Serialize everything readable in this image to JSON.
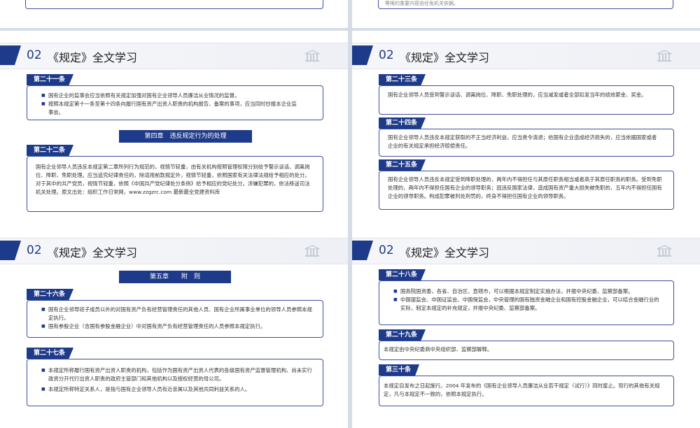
{
  "top": {
    "left_text": "",
    "right_text": "等根的重要内容由任免机关依据。"
  },
  "header": {
    "num": "02",
    "title": "《规定》全文学习"
  },
  "slide1": {
    "a21_label": "第二十一条",
    "a21_items": [
      "国有企业的监事会应当依照有关规定加强对国有企业领导人员廉洁从业情况的监督。",
      "按照本规定第十一条至第十四条向履行国有资产出资人职责的机构报告、备案的事项，应当同时抄报本企业监事会。"
    ],
    "chapter4": "第四章　违反规定行为的处理",
    "a22_label": "第二十二条",
    "a22_text": "国有企业领导人员违反本规定第二章所列行为规范的，视情节轻重，由有关机构按照管理权限分别给予警示谈话、调离岗位、降职、免职处理。应当追究纪律责任的，除适用前款规定外，视情节轻重，依照国家有关法律法规给予相应的处分。对于其中的共产党员，视情节轻重，依照《中国共产党纪律处分条例》给予相应的党纪处分。涉嫌犯罪的，依法移送司法机关处理。原文出处：组织工作日常网，www.zzgzrc.com 最新最全党建资料库"
  },
  "slide2": {
    "a23_label": "第二十三条",
    "a23_text": "国有企业领导人员受到警示谈话、调离岗位、降职、免职处理的，应当减发或者全部扣发当年的绩效薪金、奖金。",
    "a24_label": "第二十四条",
    "a24_text": "国有企业领导人员违反本规定获取的不正当经济利益，应当责令清退；给国有企业造成经济损失的，应当依据国家或者企业的有关规定承担经济赔偿责任。",
    "a25_label": "第二十五条",
    "a25_text": "国有企业领导人员违反本规定受到降职处理的，两年内不得担任与其原任职务相当或者高于其原任职务的职务。受到免职处理的，两年内不得担任国有企业的领导职务；因违反国家法律，造成国有资产重大损失被免职的，五年内不得担任国有企业的领导职务。构成犯罪被判处刑罚的，终身不得担任国有企业的领导职务。"
  },
  "slide3": {
    "chapter5": "第五章　　附　则",
    "a26_label": "第二十六条",
    "a26_items": [
      "国有企业领导班子成员以外的对国有资产负有经营管理责任的其他人员、国有企业所属事业单位的领导人员参照本规定执行。",
      "国有参股企业（含国有参股金融企业）中对国有资产负有经营管理责任的人员参照本规定执行。"
    ],
    "a27_label": "第二十七条",
    "a27_items": [
      "本规定所称履行国有资产出资人职责的机构，包括作为国有资产出资人代表的各级国有资产监督管理机构、尚未实行政资分开代行出资人职责的政府主管部门和其他机构以及授权经营的母公司。",
      "本规定所称特定关系人，是指与国有企业领导人员有近亲属以及其他共同利益关系的人。"
    ]
  },
  "slide4": {
    "a28_label": "第二十八条",
    "a28_items": [
      "国务院国资委，各省、自治区、直辖市，可以根据本规定制定实施办法，并报中央纪委、监察部备案。",
      "中国银监会、中国证监会、中国保监会，中央管理的国有独资金融企业和国有控股金融企业，可以结合金融行业的实际，制定本规定的补充规定，并报中央纪委、监察部备案。"
    ],
    "a29_label": "第二十九条",
    "a29_text": "本规定由中央纪委商中央组织部、监察部解释。",
    "a30_label": "第三十条",
    "a30_text": "本规定自发布之日起施行。2004 年发布的《国有企业领导人员廉洁从业若干规定（试行）》同时废止。现行的其他有关规定，凡与本规定不一致的，依照本规定执行。"
  }
}
